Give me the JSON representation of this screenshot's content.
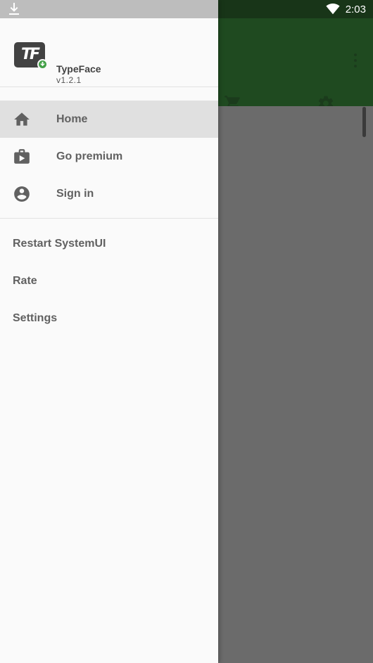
{
  "status_bar": {
    "time": "2:03"
  },
  "drawer": {
    "app_name": "TypeFace",
    "app_version": "v1.2.1",
    "logo_text": "TF",
    "primary_items": [
      {
        "label": "Home",
        "icon": "home-icon",
        "active": true
      },
      {
        "label": "Go premium",
        "icon": "briefcase-play-icon",
        "active": false
      },
      {
        "label": "Sign in",
        "icon": "account-circle-icon",
        "active": false
      }
    ],
    "secondary_items": [
      {
        "label": "Restart SystemUI"
      },
      {
        "label": "Rate"
      },
      {
        "label": "Settings"
      }
    ]
  },
  "colors": {
    "toolbar": "#1f4a20",
    "drawer_bg": "#fafafa",
    "active_item": "#e0e0e0",
    "badge": "#43a047"
  }
}
